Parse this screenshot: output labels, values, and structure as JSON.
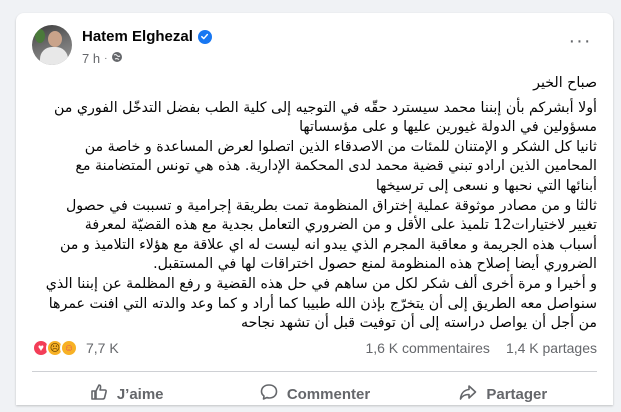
{
  "post": {
    "author": "Hatem Elghezal",
    "time": "7 h",
    "more_label": "···",
    "text_lines": [
      "صباح الخير",
      "أولا أبشركم بأن إبننا محمد سيسترد حقّه في التوجيه إلى كلية الطب بفضل التدخّل الفوري من",
      "مسؤولين في الدولة غيورين عليها و على مؤسساتها",
      "ثانيا كل الشكر و الإمتنان للمئات من الاصدقاء الذين اتصلوا لعرض المساعدة و خاصة من",
      "المحامين الذين ارادو تبني قضية محمد لدى المحكمة الإدارية. هذه هي تونس المتضامنة مع",
      "أبنائها التي نحبها و نسعى إلى ترسيخها",
      "ثالثا و من مصادر موثوقة عملية إختراق المنظومة تمت بطريقة إجرامية و تسببت في حصول",
      "تغيير لاختيارات12 تلميذ على الأقل و من الضروري التعامل بجدية مع هذه القضيّة لمعرفة",
      "أسباب هذه الجريمة و معاقبة المجرم الذي يبدو انه ليست له اي علاقة مع هؤلاء التلاميذ و من",
      "الضروري أيضا إصلاح هذه المنظومة لمنع حصول اختراقات لها في المستقبل.",
      "و أخيرا و مرة أخرى ألف شكر لكل من ساهم في حل هذه القضية و رفع المظلمة عن إبننا الذي",
      "سنواصل معه الطريق إلى أن يتخرّج بإذن الله طبيبا كما أراد و كما وعد والدته التي افنت عمرها",
      "من أجل أن يواصل دراسته إلى أن توفيت قبل أن تشهد نجاحه"
    ]
  },
  "stats": {
    "reactions_count": "7,7 K",
    "comments": "1,6 K commentaires",
    "shares": "1,4 K partages"
  },
  "actions": {
    "like_label": "J’aime",
    "comment_label": "Commenter",
    "share_label": "Partager"
  },
  "colors": {
    "accent": "#1877f2",
    "muted_text": "#65676b",
    "love": "#f33e58",
    "emoji": "#f7b125"
  },
  "icons": [
    "verified-badge-icon",
    "globe-icon",
    "more-icon",
    "love-reaction-icon",
    "sad-reaction-icon",
    "care-reaction-icon",
    "like-icon",
    "comment-icon",
    "share-icon"
  ]
}
